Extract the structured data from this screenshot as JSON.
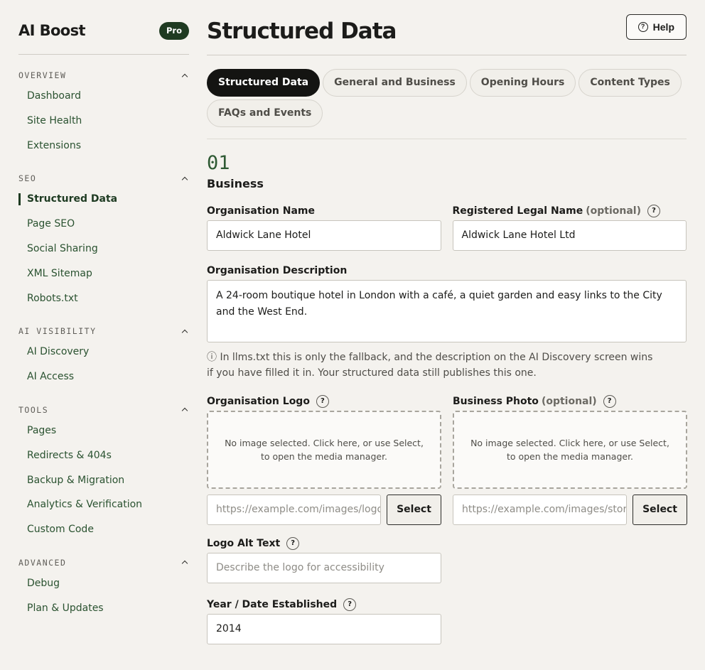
{
  "sidebar": {
    "brand": "AI Boost",
    "badge": "Pro",
    "groups": [
      {
        "title": "OVERVIEW",
        "items": [
          "Dashboard",
          "Site Health",
          "Extensions"
        ]
      },
      {
        "title": "SEO",
        "items": [
          "Structured Data",
          "Page SEO",
          "Social Sharing",
          "XML Sitemap",
          "Robots.txt"
        ]
      },
      {
        "title": "AI VISIBILITY",
        "items": [
          "AI Discovery",
          "AI Access"
        ]
      },
      {
        "title": "TOOLS",
        "items": [
          "Pages",
          "Redirects & 404s",
          "Backup & Migration",
          "Analytics & Verification",
          "Custom Code"
        ]
      },
      {
        "title": "ADVANCED",
        "items": [
          "Debug",
          "Plan & Updates"
        ]
      }
    ],
    "active_item": "Structured Data"
  },
  "header": {
    "title": "Structured Data",
    "help_label": "Help",
    "help_icon": "?"
  },
  "tabs": [
    "Structured Data",
    "General and Business",
    "Opening Hours",
    "Content Types",
    "FAQs and Events"
  ],
  "active_tab": "Structured Data",
  "section": {
    "number": "01",
    "title": "Business"
  },
  "form": {
    "org_name": {
      "label": "Organisation Name",
      "value": "Aldwick Lane Hotel"
    },
    "legal_name": {
      "label": "Registered Legal Name",
      "optional": "(optional)",
      "value": "Aldwick Lane Hotel Ltd"
    },
    "description": {
      "label": "Organisation Description",
      "value": "A 24-room boutique hotel in London with a café, a quiet garden and easy links to the City and the West End.",
      "note": "ⓘ In llms.txt this is only the fallback, and the description on the AI Discovery screen wins if you have filled it in. Your structured data still publishes this one."
    },
    "logo": {
      "label": "Organisation Logo",
      "dropzone_text": "No image selected. Click here, or use Select, to open the media manager.",
      "url_placeholder": "https://example.com/images/logo.png",
      "select_label": "Select"
    },
    "photo": {
      "label": "Business Photo",
      "optional": "(optional)",
      "dropzone_text": "No image selected. Click here, or use Select, to open the media manager.",
      "url_placeholder": "https://example.com/images/storefront.jpg",
      "select_label": "Select"
    },
    "logo_alt": {
      "label": "Logo Alt Text",
      "placeholder": "Describe the logo for accessibility"
    },
    "established": {
      "label": "Year / Date Established",
      "value": "2014"
    },
    "help_marker": "?"
  }
}
